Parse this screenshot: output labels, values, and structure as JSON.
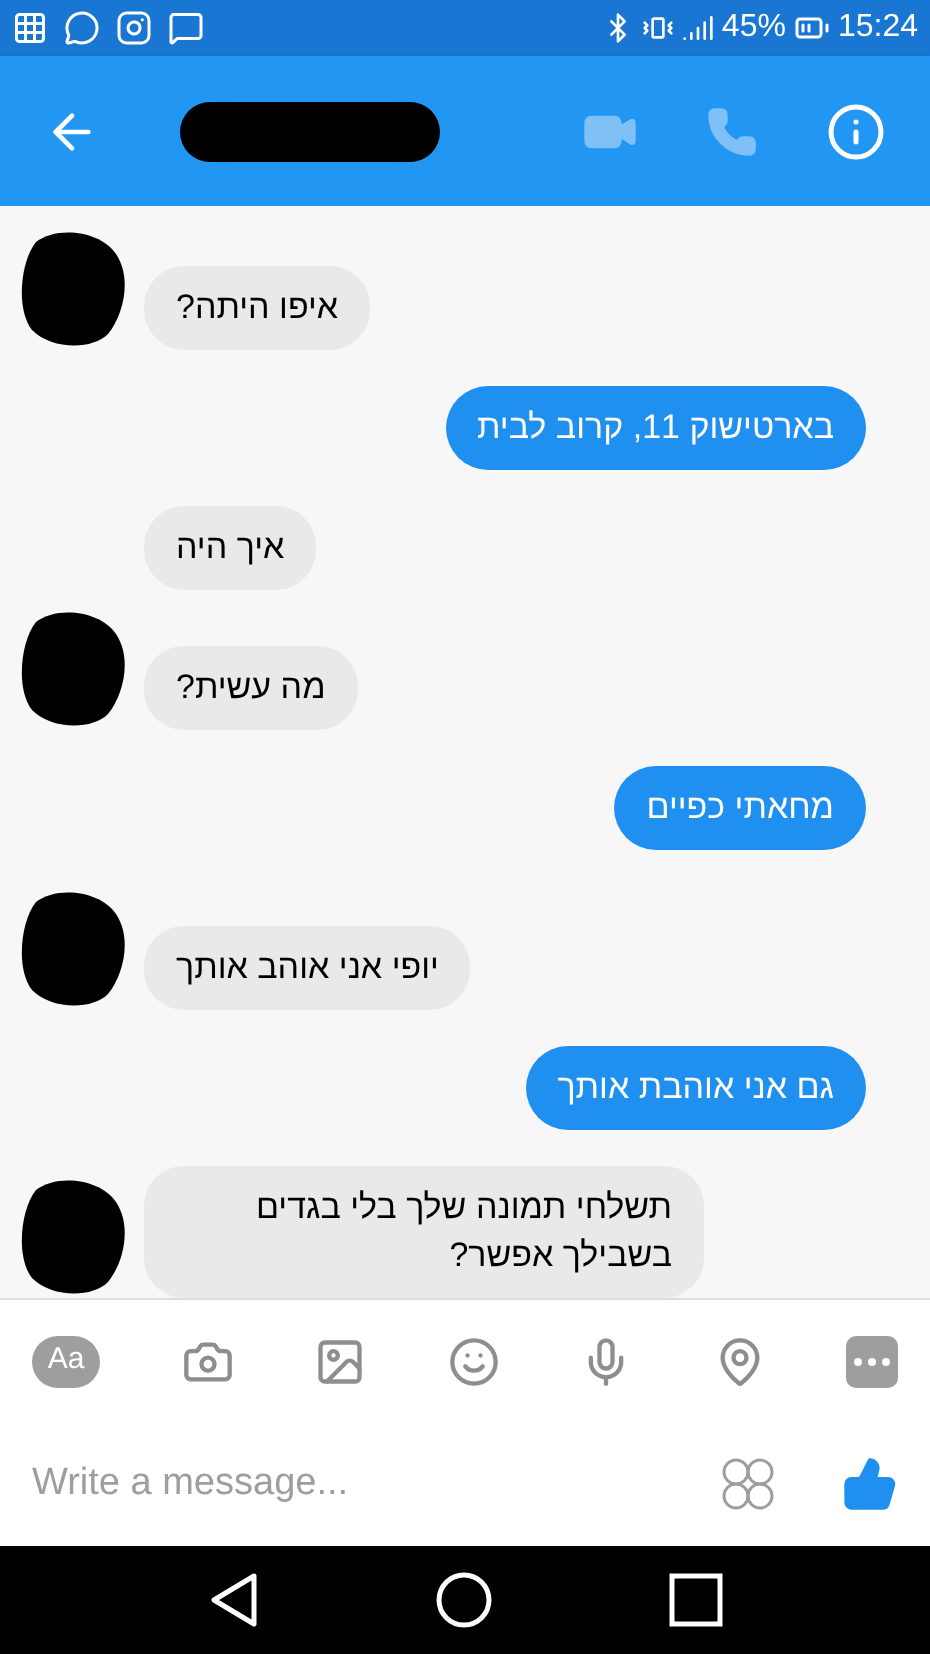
{
  "status_bar": {
    "battery": "45%",
    "time": "15:24"
  },
  "messages": [
    {
      "kind": "incoming",
      "text": "איפו היתה?",
      "avatar": true
    },
    {
      "kind": "outgoing",
      "text": "בארטישוק 11, קרוב לבית"
    },
    {
      "kind": "incoming",
      "text": "איך היה",
      "avatar": false
    },
    {
      "kind": "incoming",
      "text": "מה עשית?",
      "avatar": true
    },
    {
      "kind": "outgoing",
      "text": "מחאתי כפיים"
    },
    {
      "kind": "incoming",
      "text": "יופי אני אוהב אותך",
      "avatar": true
    },
    {
      "kind": "outgoing",
      "text": "גם אני אוהבת אותך"
    },
    {
      "kind": "incoming",
      "text": "תשלחי תמונה שלך בלי בגדים בשבילך אפשר?",
      "avatar": true
    }
  ],
  "composer": {
    "aa": "Aa",
    "placeholder": "Write a message..."
  }
}
